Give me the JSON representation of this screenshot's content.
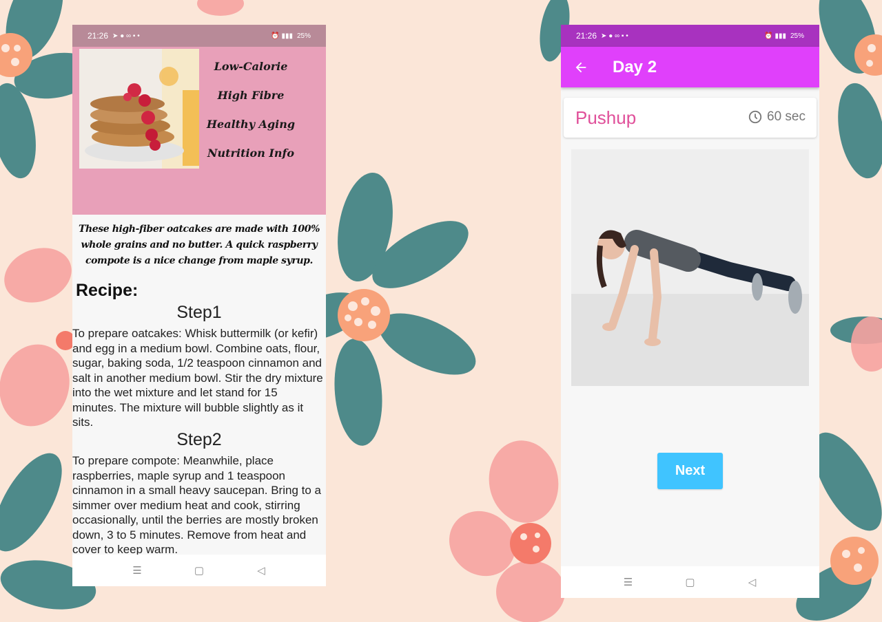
{
  "left_screen": {
    "status": {
      "time": "21:26",
      "battery": "25%"
    },
    "menu": [
      "Low-Calorie",
      "High Fibre",
      "Healthy Aging",
      "Nutrition Info"
    ],
    "intro": "These high-fiber oatcakes are made with 100% whole grains and no butter. A quick raspberry compote is a nice change from maple syrup.",
    "recipe_heading": "Recipe:",
    "steps": [
      {
        "title": "Step1",
        "text": "To prepare oatcakes: Whisk buttermilk (or kefir) and egg in a medium bowl. Combine oats, flour, sugar, baking soda, 1/2 teaspoon cinnamon and salt in another medium bowl. Stir the dry mixture into the wet mixture and let stand for 15 minutes. The mixture will bubble slightly as it sits."
      },
      {
        "title": "Step2",
        "text": "To prepare compote: Meanwhile, place raspberries, maple syrup and 1 teaspoon cinnamon in a small heavy saucepan. Bring to a simmer over medium heat and cook, stirring occasionally, until the berries are mostly broken down, 3 to 5 minutes. Remove from heat and cover to keep warm."
      }
    ],
    "nav": {
      "menu_glyph": "☰",
      "home_glyph": "▢",
      "back_glyph": "◁"
    },
    "colors": {
      "header_bg": "#e8a0b9",
      "status_bg": "#b88a98"
    }
  },
  "right_screen": {
    "status": {
      "time": "21:26",
      "battery": "25%"
    },
    "appbar": {
      "title": "Day 2",
      "back_icon": "arrow-left-icon"
    },
    "exercise": {
      "name": "Pushup",
      "duration": "60 sec",
      "timer_icon": "clock-icon"
    },
    "next_label": "Next",
    "nav": {
      "menu_glyph": "☰",
      "home_glyph": "▢",
      "back_glyph": "◁"
    },
    "colors": {
      "appbar_bg": "#e040fb",
      "status_bg": "#a832bf",
      "exercise_name": "#e0509a",
      "next_bg": "#40c4ff"
    }
  }
}
